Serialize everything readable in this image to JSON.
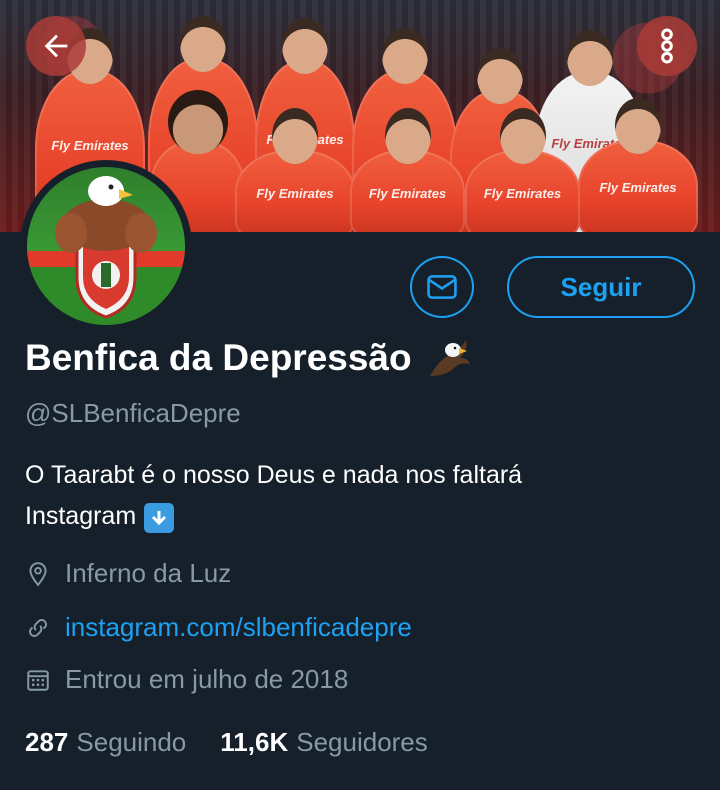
{
  "header": {
    "back_icon": "arrow-left-icon",
    "more_icon": "more-vertical-icon",
    "banner": {
      "sponsor_text": "Fly Emirates"
    }
  },
  "actions": {
    "message_icon": "mail-icon",
    "follow_label": "Seguir"
  },
  "profile": {
    "display_name": "Benfica da Depressão",
    "name_emoji": "eagle-emoji",
    "handle": "@SLBenficaDepre",
    "bio_line1": "O Taarabt é o nosso Deus e nada nos faltará",
    "bio_line2": "Instagram",
    "bio_emoji": "down-arrow-emoji",
    "location": "Inferno da Luz",
    "website": "instagram.com/slbenficadepre",
    "joined": "Entrou em julho de 2018"
  },
  "stats": {
    "following_count": "287",
    "following_label": "Seguindo",
    "followers_count": "11,6K",
    "followers_label": "Seguidores"
  },
  "colors": {
    "background": "#15202b",
    "accent": "#1da1f2",
    "secondary_text": "#8899a6"
  }
}
